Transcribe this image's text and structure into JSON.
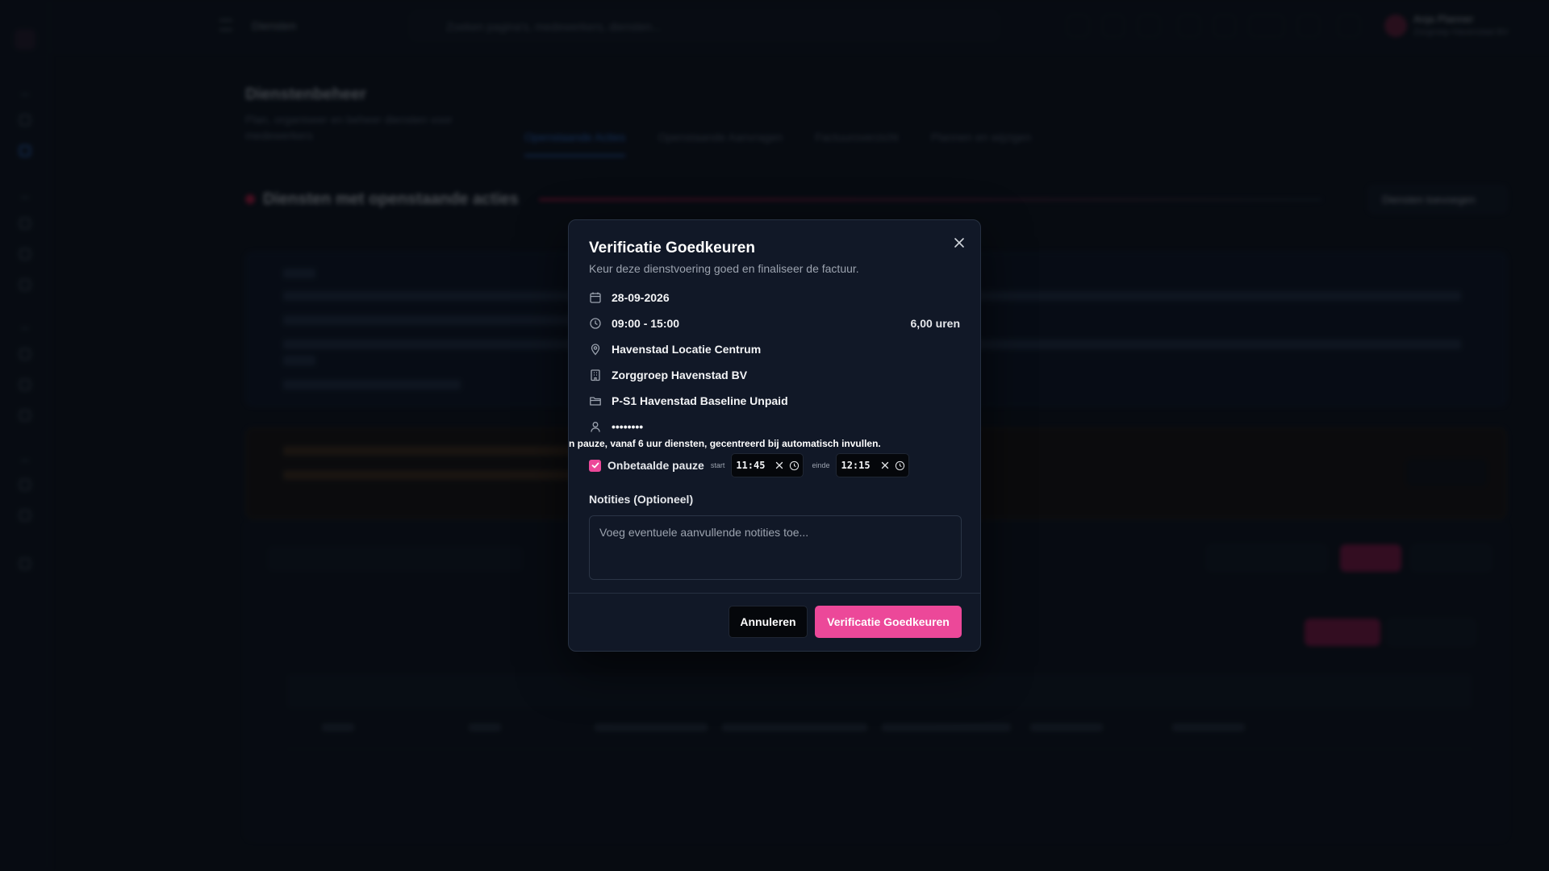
{
  "topbar": {
    "breadcrumb": "Diensten",
    "search_placeholder": "Zoeken pagina's, medewerkers, diensten...",
    "user_name": "Anja Planner",
    "user_org": "Zorgroep Havenstad BV"
  },
  "page": {
    "title": "Dienstenbeheer",
    "subtitle": "Plan, organiseer en beheer diensten voor medewerkers",
    "tabs": [
      "Openstaande Acties",
      "Openstaande Aanvragen",
      "Factuuroverzicht",
      "Plannen en wijzigen"
    ],
    "section_title": "Diensten met openstaande acties",
    "add_button": "Diensten toevoegen"
  },
  "modal": {
    "title": "Verificatie Goedkeuren",
    "subtitle": "Keur deze dienstvoering goed en finaliseer de factuur.",
    "date": "28-09-2026",
    "time": "09:00 - 15:00",
    "hours": "6,00 uren",
    "location": "Havenstad Locatie Centrum",
    "client": "Zorggroep Havenstad BV",
    "project": "P-S1 Havenstad Baseline Unpaid",
    "employee": "••••••••",
    "pause_hint": "n pauze, vanaf 6 uur diensten, gecentreerd bij automatisch invullen.",
    "pause_label": "Onbetaalde pauze",
    "pause_checked": true,
    "start_label": "start",
    "start_value": "11:45",
    "end_label": "einde",
    "end_value": "12:15",
    "notes_label": "Notities (Optioneel)",
    "notes_placeholder": "Voeg eventuele aanvullende notities toe...",
    "cancel_label": "Annuleren",
    "confirm_label": "Verificatie Goedkeuren"
  },
  "colors": {
    "accent": "#ec4899",
    "modal_bg": "#111827",
    "page_bg": "#0b0f17"
  }
}
